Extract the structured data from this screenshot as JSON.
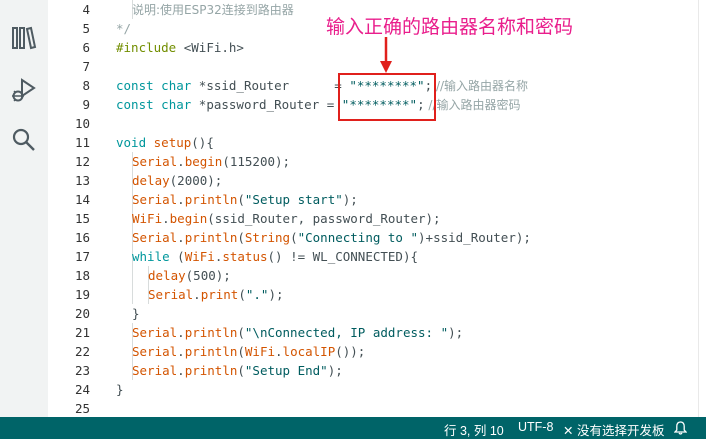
{
  "editor": {
    "lines": [
      {
        "num": "4",
        "comment": "说明:使用ESP32连接到路由器"
      },
      {
        "num": "5",
        "comment": "*/"
      },
      {
        "num": "6",
        "pre": "#include",
        "rest": " <WiFi.h>"
      },
      {
        "num": "7"
      },
      {
        "num": "8",
        "kw1": "const",
        "kw2": "char",
        "decl": " *ssid_Router      = ",
        "str": "\"********\"",
        "semi": ";",
        "comment": " //输入路由器名称"
      },
      {
        "num": "9",
        "kw1": "const",
        "kw2": "char",
        "decl": " *password_Router = ",
        "str": "\"********\"",
        "semi": ";",
        "comment": " //输入路由器密码"
      },
      {
        "num": "10"
      },
      {
        "num": "11",
        "kw": "void",
        "fn": "setup",
        "rest": "(){"
      },
      {
        "num": "12",
        "obj": "Serial",
        "dot": ".",
        "fn": "begin",
        "rest": "(115200);"
      },
      {
        "num": "13",
        "fn": "delay",
        "rest": "(2000);"
      },
      {
        "num": "14",
        "obj": "Serial",
        "dot": ".",
        "fn": "println",
        "open": "(",
        "str": "\"Setup start\"",
        "rest": ");"
      },
      {
        "num": "15",
        "obj": "WiFi",
        "dot": ".",
        "fn": "begin",
        "rest": "(ssid_Router, password_Router);"
      },
      {
        "num": "16",
        "obj": "Serial",
        "dot": ".",
        "fn": "println",
        "open": "(",
        "fn2": "String",
        "open2": "(",
        "str": "\"Connecting to \"",
        "rest": ")+ssid_Router);"
      },
      {
        "num": "17",
        "kw": "while",
        "open": " (",
        "obj": "WiFi",
        "dot": ".",
        "fn": "status",
        "rest": "() != WL_CONNECTED){"
      },
      {
        "num": "18",
        "fn": "delay",
        "rest": "(500);"
      },
      {
        "num": "19",
        "obj": "Serial",
        "dot": ".",
        "fn": "print",
        "open": "(",
        "str": "\".\"",
        "rest": ");"
      },
      {
        "num": "20",
        "rest": "}"
      },
      {
        "num": "21",
        "obj": "Serial",
        "dot": ".",
        "fn": "println",
        "open": "(",
        "str": "\"\\nConnected, IP address: \"",
        "rest": ");"
      },
      {
        "num": "22",
        "obj": "Serial",
        "dot": ".",
        "fn": "println",
        "open": "(",
        "obj2": "WiFi",
        "dot2": ".",
        "fn2": "localIP",
        "rest": "());"
      },
      {
        "num": "23",
        "obj": "Serial",
        "dot": ".",
        "fn": "println",
        "open": "(",
        "str": "\"Setup End\"",
        "rest": ");"
      },
      {
        "num": "24",
        "rest": "}"
      },
      {
        "num": "25"
      }
    ]
  },
  "annotation": {
    "text": "输入正确的路由器名称和密码"
  },
  "statusbar": {
    "position": "行 3, 列 10",
    "encoding": "UTF-8",
    "board": "✕ 没有选择开发板"
  },
  "icons": {
    "activity": [
      "library-icon",
      "debug-icon",
      "search-icon"
    ],
    "status": "bell-icon"
  },
  "colors": {
    "statusbar": "#006468",
    "annotation": "#e91e8c",
    "highlight_box": "#e0201c"
  }
}
